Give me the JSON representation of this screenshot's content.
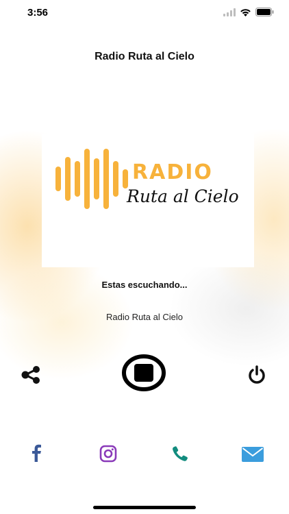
{
  "status_bar": {
    "time": "3:56",
    "icons": [
      "signal-icon",
      "wifi-icon",
      "battery-icon"
    ]
  },
  "header": {
    "title": "Radio Ruta al Cielo"
  },
  "logo": {
    "word": "RADIO",
    "script": "Ruta al Cielo",
    "accent": "#f7b23b"
  },
  "player": {
    "listening_label": "Estas escuchando...",
    "station_name": "Radio Ruta al Cielo",
    "controls": [
      "share-icon",
      "stop-icon",
      "power-icon"
    ]
  },
  "social": {
    "items": [
      {
        "name": "facebook-icon",
        "color": "#3b5998"
      },
      {
        "name": "instagram-icon",
        "color": "#8a3ab9"
      },
      {
        "name": "phone-icon",
        "color": "#128c7e"
      },
      {
        "name": "email-icon",
        "color": "#3b9ddd"
      }
    ]
  }
}
